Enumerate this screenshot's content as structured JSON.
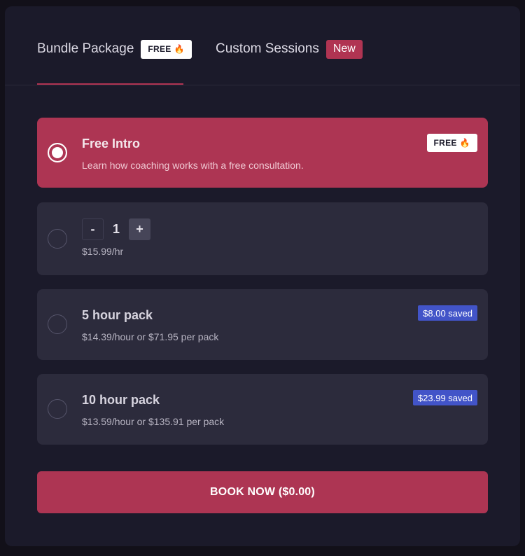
{
  "tabs": {
    "bundle": {
      "label": "Bundle Package",
      "badge": "FREE"
    },
    "custom": {
      "label": "Custom Sessions",
      "badge": "New"
    }
  },
  "options": {
    "free_intro": {
      "title": "Free Intro",
      "subtitle": "Learn how coaching works with a free consultation.",
      "badge": "FREE",
      "selected": true
    },
    "custom_hours": {
      "quantity": "1",
      "minus": "-",
      "plus": "+",
      "price": "$15.99/hr"
    },
    "five_hour": {
      "title": "5 hour pack",
      "subtitle": "$14.39/hour or $71.95 per pack",
      "saved": "$8.00 saved"
    },
    "ten_hour": {
      "title": "10 hour pack",
      "subtitle": "$13.59/hour or $135.91 per pack",
      "saved": "$23.99 saved"
    }
  },
  "book_button": {
    "label": "BOOK NOW ($0.00)"
  },
  "icons": {
    "badge_flame": "flame-icon"
  },
  "colors": {
    "accent": "#ad3553",
    "saved_badge": "#4254c8",
    "panel": "#1b1a2a",
    "card": "#2c2b3c"
  }
}
